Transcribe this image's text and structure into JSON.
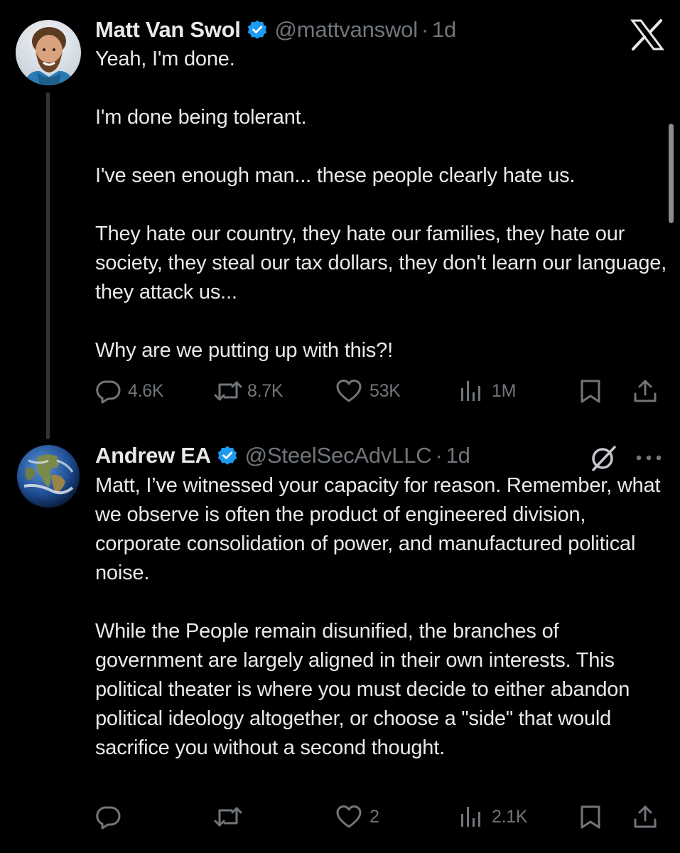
{
  "tweets": [
    {
      "display_name": "Matt Van Swol",
      "handle": "@mattvanswol",
      "separator": "·",
      "time": "1d",
      "paragraphs": [
        "Yeah, I'm done.",
        "I'm done being tolerant.",
        "I've seen enough man... these people clearly hate us.",
        "They hate our country, they hate our families, they hate our society, they steal our tax dollars, they don't learn our language, they attack us...",
        "Why are we putting up with this?!"
      ],
      "replies": "4.6K",
      "reposts": "8.7K",
      "likes": "53K",
      "views": "1M"
    },
    {
      "display_name": "Andrew EA",
      "handle": "@SteelSecAdvLLC",
      "separator": "·",
      "time": "1d",
      "paragraphs": [
        "Matt, I’ve witnessed your capacity for reason. Remember, what we observe is often the product of engineered division, corporate consolidation of power, and manufactured political noise.",
        "While the People remain disunified, the branches of government are largely aligned in their own interests. This political theater is where you must decide to either abandon political ideology altogether, or choose a \"side\" that would sacrifice you without a second thought."
      ],
      "replies": "",
      "reposts": "",
      "likes": "2",
      "views": "2.1K"
    }
  ],
  "colors": {
    "background": "#000000",
    "text": "#e7e9ea",
    "secondary": "#71767b",
    "verified_badge": "#1d9bf0",
    "thread_line": "#333639"
  },
  "icons": {
    "app_logo": "x-logo-icon",
    "reply": "reply-icon",
    "repost": "repost-icon",
    "like": "heart-icon",
    "views": "views-icon",
    "bookmark": "bookmark-icon",
    "share": "share-icon",
    "grok": "grok-icon",
    "more": "more-icon"
  }
}
